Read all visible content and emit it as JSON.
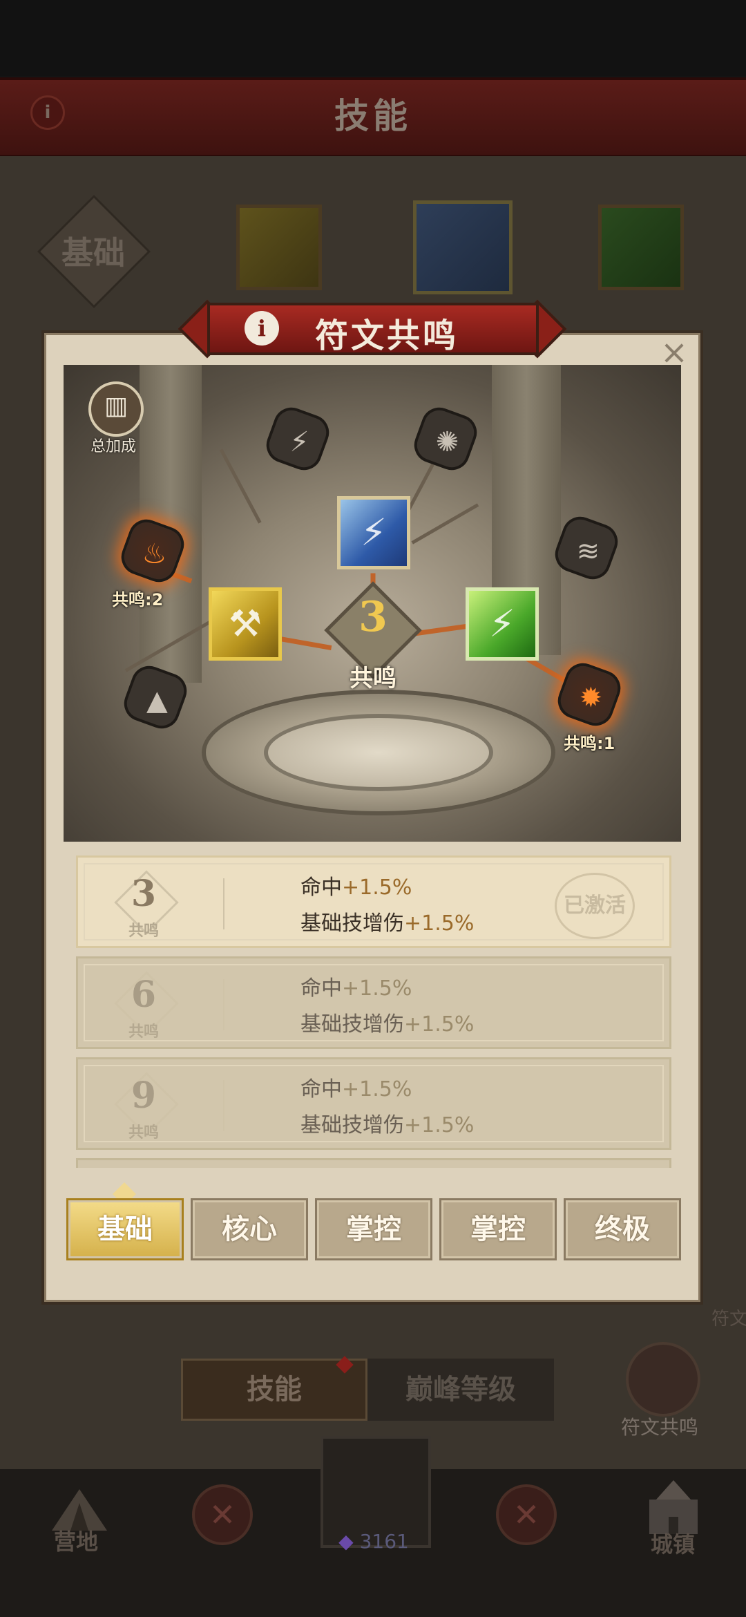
{
  "background": {
    "screen_title": "技能",
    "category_label": "基础",
    "bottom_tabs": [
      "技能",
      "巅峰等级"
    ],
    "rune_button_label": "符文共鸣",
    "nav": {
      "camp": "营地",
      "town": "城镇",
      "currency_value": "3161",
      "partial_text": "符文合"
    }
  },
  "modal": {
    "title": "符文共鸣",
    "close_symbol": "×",
    "info_symbol": "i",
    "bonus_button_label": "总加成",
    "center": {
      "count": "3",
      "label": "共鸣"
    },
    "node_labels": {
      "left_hot": "共鸣:2",
      "right_hot": "共鸣:1"
    },
    "tiers": [
      {
        "num": "3",
        "label": "共鸣",
        "stat1_name": "命中",
        "stat1_value": "+1.5%",
        "stat2_name": "基础技增伤",
        "stat2_value": "+1.5%",
        "status": "已激活",
        "active": true
      },
      {
        "num": "6",
        "label": "共鸣",
        "stat1_name": "命中",
        "stat1_value": "+1.5%",
        "stat2_name": "基础技增伤",
        "stat2_value": "+1.5%",
        "status": "",
        "active": false
      },
      {
        "num": "9",
        "label": "共鸣",
        "stat1_name": "命中",
        "stat1_value": "+1.5%",
        "stat2_name": "基础技增伤",
        "stat2_value": "+1.5%",
        "status": "",
        "active": false
      }
    ],
    "category_tabs": [
      "基础",
      "核心",
      "掌控",
      "掌控",
      "终极"
    ],
    "selected_tab": "基础"
  },
  "colors": {
    "accent_orange": "#c0642a",
    "header_red": "#a82a22",
    "active_tab_gold": "#d4b04a"
  }
}
